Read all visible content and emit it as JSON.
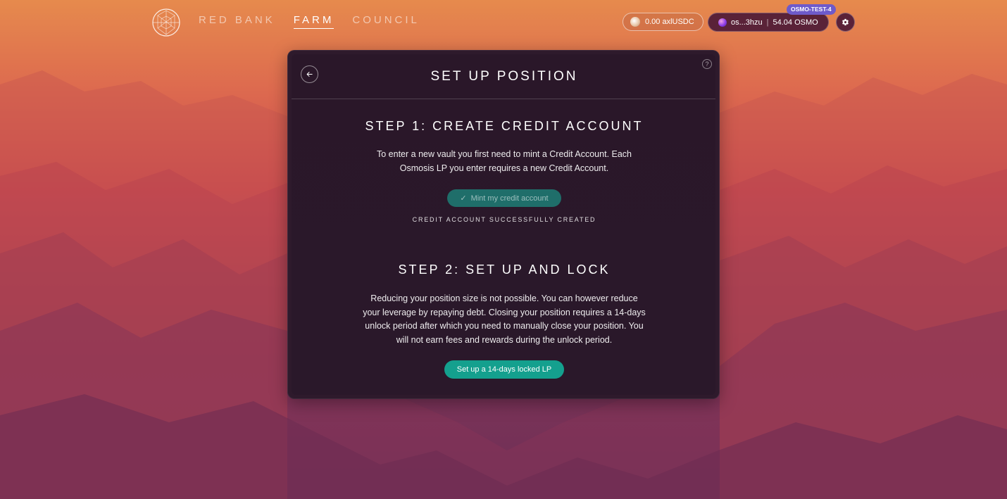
{
  "nav": {
    "items": [
      {
        "label": "RED BANK",
        "active": false
      },
      {
        "label": "FARM",
        "active": true
      },
      {
        "label": "COUNCIL",
        "active": false
      }
    ]
  },
  "header": {
    "balance": "0.00 axlUSDC",
    "wallet_address": "os...3hzu",
    "wallet_balance": "54.04 OSMO",
    "network": "OSMO-TEST-4"
  },
  "card": {
    "title": "SET UP POSITION",
    "help": "?",
    "step1": {
      "title": "STEP 1: CREATE CREDIT ACCOUNT",
      "text": "To enter a new vault you first need to mint a Credit Account. Each Osmosis LP you enter requires a new Credit Account.",
      "button_label": "Mint my credit account",
      "status": "CREDIT ACCOUNT SUCCESSFULLY CREATED"
    },
    "step2": {
      "title": "STEP 2: SET UP AND LOCK",
      "text": "Reducing your position size is not possible. You can however reduce your leverage by repaying debt. Closing your position requires a 14-days unlock period after which you need to manually close your position. You will not earn fees and rewards during the unlock period.",
      "button_label": "Set up a 14-days locked LP"
    }
  },
  "colors": {
    "accent": "#14a08e",
    "accent_disabled": "#1f6e6a",
    "network_badge": "#6e5acb",
    "card_bg": "#2e1a2c"
  }
}
